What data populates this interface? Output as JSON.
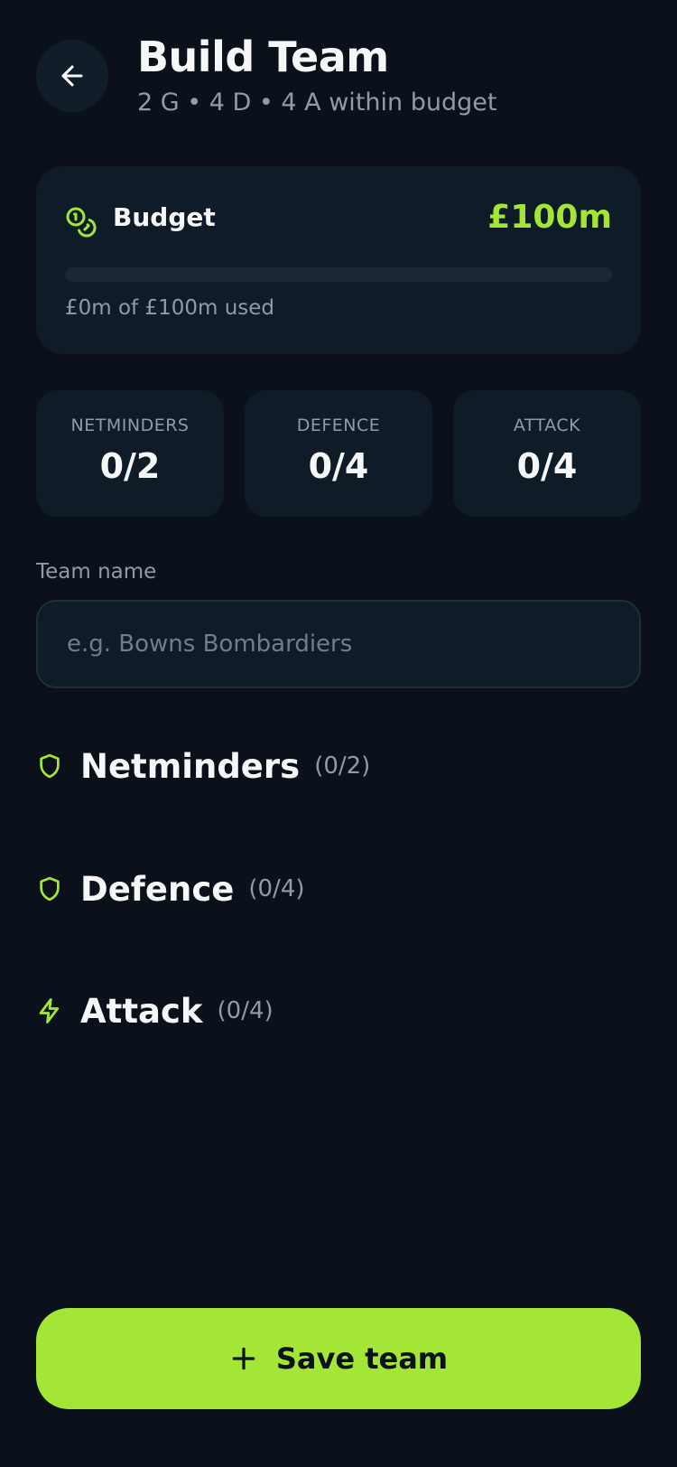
{
  "header": {
    "title": "Build Team",
    "subtitle": "2 G • 4 D • 4 A within budget",
    "back_icon": "arrow-left-icon"
  },
  "budget": {
    "label": "Budget",
    "total": "£100m",
    "used_text": "£0m of £100m used",
    "used_fraction": 0,
    "icon": "coins-icon"
  },
  "stats": [
    {
      "label": "NETMINDERS",
      "value": "0/2"
    },
    {
      "label": "DEFENCE",
      "value": "0/4"
    },
    {
      "label": "ATTACK",
      "value": "0/4"
    }
  ],
  "team_name": {
    "label": "Team name",
    "placeholder": "e.g. Bowns Bombardiers",
    "value": ""
  },
  "sections": [
    {
      "title": "Netminders",
      "count": "(0/2)",
      "icon": "shield-icon"
    },
    {
      "title": "Defence",
      "count": "(0/4)",
      "icon": "shield-icon"
    },
    {
      "title": "Attack",
      "count": "(0/4)",
      "icon": "lightning-icon"
    }
  ],
  "save_button": {
    "label": "Save team",
    "icon": "plus-icon"
  },
  "colors": {
    "background": "#0a111a",
    "card": "#0f1c28",
    "accent": "#a3e635",
    "muted_text": "#8e9bab"
  }
}
